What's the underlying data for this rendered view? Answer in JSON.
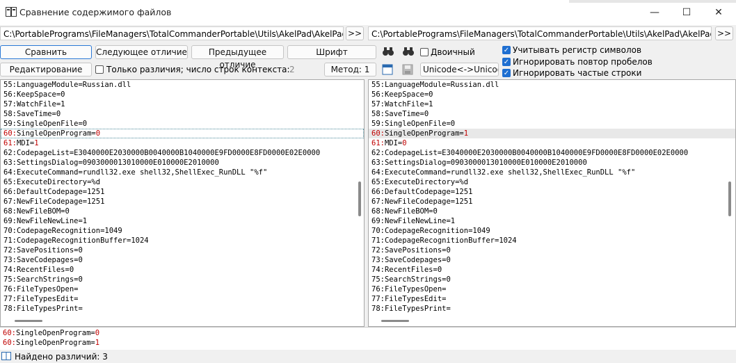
{
  "window": {
    "title": "Сравнение содержимого файлов",
    "minimize_glyph": "—",
    "maximize_glyph": "☐",
    "close_glyph": "✕"
  },
  "paths": {
    "left": "C:\\PortablePrograms\\FileManagers\\TotalCommanderPortable\\Utils\\AkelPad\\AkelPad.ini",
    "right": "C:\\PortablePrograms\\FileManagers\\TotalCommanderPortable\\Utils\\AkelPad\\AkelPadL.ini",
    "left_browse": ">>",
    "right_browse": ">>"
  },
  "toolbar": {
    "compare": "Сравнить",
    "next_diff": "Следующее отличие",
    "prev_diff": "Предыдущее отличие",
    "font": "Шрифт",
    "binary": "Двоичный",
    "edit": "Редактирование",
    "only_diffs": "Только различия; число строк контекста:",
    "context_lines": "2",
    "method": "Метод: 1",
    "encoding": "Unicode<->Unicode",
    "case_sensitive": "Учитывать регистр символов",
    "ignore_spaces": "Игнорировать повтор пробелов",
    "ignore_lines": "Игнорировать частые строки"
  },
  "left_lines": [
    {
      "n": "55:",
      "t": "LanguageModule=Russian.dll"
    },
    {
      "n": "56:",
      "t": "KeepSpace=0"
    },
    {
      "n": "57:",
      "t": "WatchFile=1"
    },
    {
      "n": "58:",
      "t": "SaveTime=0"
    },
    {
      "n": "59:",
      "t": "SingleOpenFile=0"
    },
    {
      "n": "60:",
      "t": "SingleOpenProgram=0"
    },
    {
      "n": "61:",
      "t": "MDI=1"
    },
    {
      "n": "62:",
      "t": "CodepageList=E3040000E2030000B0040000B1040000E9FD0000E8FD0000E02E0000"
    },
    {
      "n": "63:",
      "t": "SettingsDialog=0903000013010000E010000E2010000"
    },
    {
      "n": "64:",
      "t": "ExecuteCommand=rundll32.exe shell32,ShellExec_RunDLL \"%f\""
    },
    {
      "n": "65:",
      "t": "ExecuteDirectory=%d"
    },
    {
      "n": "66:",
      "t": "DefaultCodepage=1251"
    },
    {
      "n": "67:",
      "t": "NewFileCodepage=1251"
    },
    {
      "n": "68:",
      "t": "NewFileBOM=0"
    },
    {
      "n": "69:",
      "t": "NewFileNewLine=1"
    },
    {
      "n": "70:",
      "t": "CodepageRecognition=1049"
    },
    {
      "n": "71:",
      "t": "CodepageRecognitionBuffer=1024"
    },
    {
      "n": "72:",
      "t": "SavePositions=0"
    },
    {
      "n": "73:",
      "t": "SaveCodepages=0"
    },
    {
      "n": "74:",
      "t": "RecentFiles=0"
    },
    {
      "n": "75:",
      "t": "SearchStrings=0"
    },
    {
      "n": "76:",
      "t": "FileTypesOpen="
    },
    {
      "n": "77:",
      "t": "FileTypesEdit="
    },
    {
      "n": "78:",
      "t": "FileTypesPrint="
    }
  ],
  "right_lines": [
    {
      "n": "55:",
      "t": "LanguageModule=Russian.dll"
    },
    {
      "n": "56:",
      "t": "KeepSpace=0"
    },
    {
      "n": "57:",
      "t": "WatchFile=1"
    },
    {
      "n": "58:",
      "t": "SaveTime=0"
    },
    {
      "n": "59:",
      "t": "SingleOpenFile=0"
    },
    {
      "n": "60:",
      "t": "SingleOpenProgram=1"
    },
    {
      "n": "61:",
      "t": "MDI=0"
    },
    {
      "n": "62:",
      "t": "CodepageList=E3040000E2030000B0040000B1040000E9FD0000E8FD0000E02E0000"
    },
    {
      "n": "63:",
      "t": "SettingsDialog=0903000013010000E010000E2010000"
    },
    {
      "n": "64:",
      "t": "ExecuteCommand=rundll32.exe shell32,ShellExec_RunDLL \"%f\""
    },
    {
      "n": "65:",
      "t": "ExecuteDirectory=%d"
    },
    {
      "n": "66:",
      "t": "DefaultCodepage=1251"
    },
    {
      "n": "67:",
      "t": "NewFileCodepage=1251"
    },
    {
      "n": "68:",
      "t": "NewFileBOM=0"
    },
    {
      "n": "69:",
      "t": "NewFileNewLine=1"
    },
    {
      "n": "70:",
      "t": "CodepageRecognition=1049"
    },
    {
      "n": "71:",
      "t": "CodepageRecognitionBuffer=1024"
    },
    {
      "n": "72:",
      "t": "SavePositions=0"
    },
    {
      "n": "73:",
      "t": "SaveCodepages=0"
    },
    {
      "n": "74:",
      "t": "RecentFiles=0"
    },
    {
      "n": "75:",
      "t": "SearchStrings=0"
    },
    {
      "n": "76:",
      "t": "FileTypesOpen="
    },
    {
      "n": "77:",
      "t": "FileTypesEdit="
    },
    {
      "n": "78:",
      "t": "FileTypesPrint="
    }
  ],
  "diff_rows": [
    5,
    6
  ],
  "bottom_lines": [
    {
      "n": "60:",
      "t": "SingleOpenProgram=0"
    },
    {
      "n": "60:",
      "t": "SingleOpenProgram=1"
    }
  ],
  "status": {
    "text": "Найдено различий: 3"
  }
}
